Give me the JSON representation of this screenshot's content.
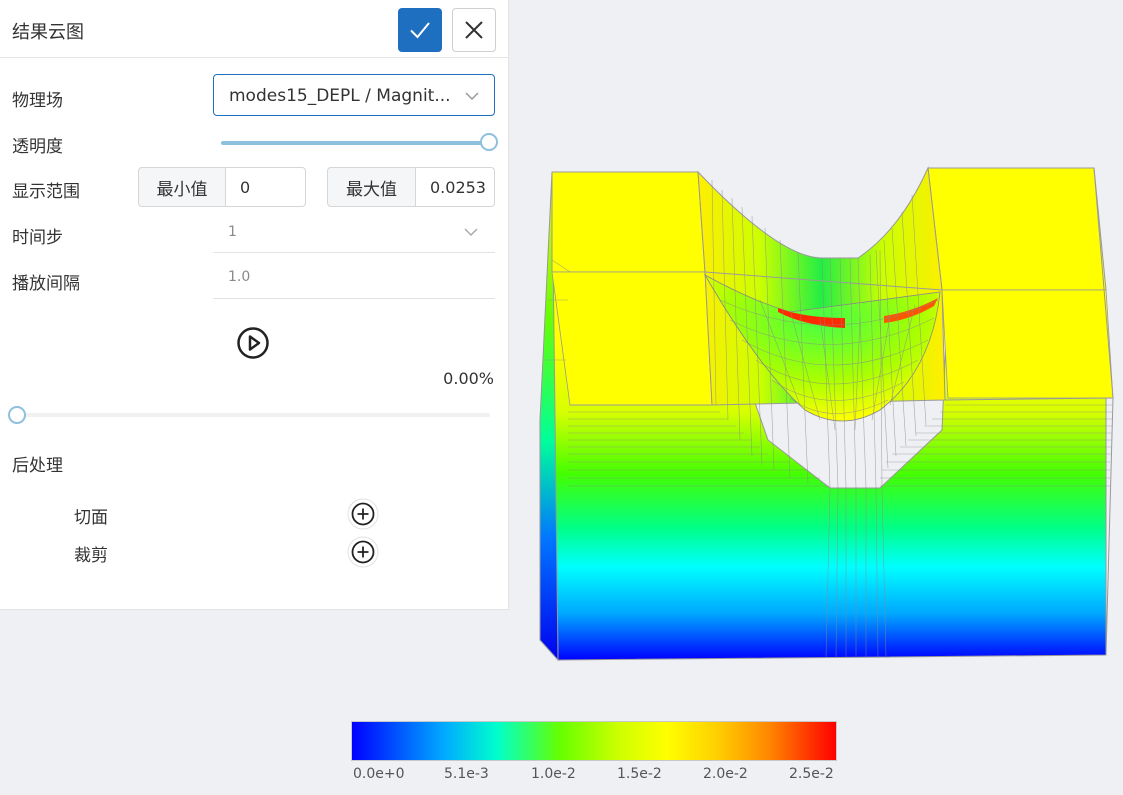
{
  "panel": {
    "title": "结果云图",
    "field_label": "物理场",
    "field_value": "modes15_DEPL / Magnit...",
    "opacity_label": "透明度",
    "opacity_value": 1.0,
    "range_label": "显示范围",
    "min_label": "最小值",
    "min_value": "0",
    "max_label": "最大值",
    "max_value": "0.0253",
    "timestep_label": "时间步",
    "timestep_value": "1",
    "interval_label": "播放间隔",
    "interval_value": "1.0",
    "progress_text": "0.00%",
    "progress_value": 0.0,
    "postprocess_label": "后处理",
    "section_label": "切面",
    "clip_label": "裁剪"
  },
  "icons": {
    "confirm": "check-icon",
    "close": "close-icon",
    "dropdown": "chevron-down-icon",
    "play": "play-circle-icon",
    "add": "plus-circle-icon"
  },
  "colors": {
    "primary": "#1f6fc0",
    "slider": "#8ec0de"
  },
  "colorbar": {
    "ticks": [
      "0.0e+0",
      "5.1e-3",
      "1.0e-2",
      "1.5e-2",
      "2.0e-2",
      "2.5e-2"
    ]
  }
}
